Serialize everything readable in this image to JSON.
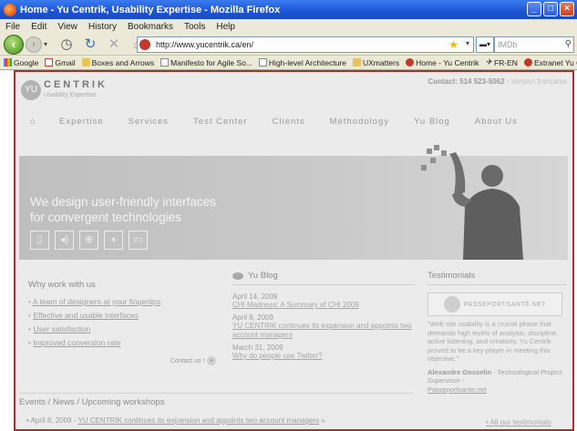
{
  "window": {
    "title": "Home - Yu Centrik, Usability Expertise - Mozilla Firefox",
    "controls": [
      "_",
      "□",
      "×"
    ]
  },
  "menu": [
    "File",
    "Edit",
    "View",
    "History",
    "Bookmarks",
    "Tools",
    "Help"
  ],
  "navbar": {
    "url": "http://www.yucentrik.ca/en/",
    "search_engine": "▬▾",
    "search_placeholder": "IMDb"
  },
  "bookmarks": [
    {
      "label": "Google",
      "icon": "google-icon"
    },
    {
      "label": "Gmail",
      "icon": "gmail-icon"
    },
    {
      "label": "Boxes and Arrows",
      "icon": "folder-icon"
    },
    {
      "label": "Manifesto for Agile So...",
      "icon": "page-icon"
    },
    {
      "label": "High-level Architecture",
      "icon": "page-icon"
    },
    {
      "label": "UXmatters",
      "icon": "folder-icon"
    },
    {
      "label": "Home - Yu Centrik",
      "icon": "yu-icon"
    },
    {
      "label": "FR-EN",
      "icon": "fren-icon"
    },
    {
      "label": "Extranet Yu Centrik",
      "icon": "yu-icon"
    }
  ],
  "site": {
    "logo_mark": "YU",
    "logo_name": "CENTRIK",
    "logo_tagline": "Usability Expertise",
    "contact_label": "Contact: 514 523-5062",
    "contact_separator": " - ",
    "contact_lang": "Version française",
    "nav": [
      "Expertise",
      "Services",
      "Test Center",
      "Clients",
      "Methodology",
      "Yu Blog",
      "About Us"
    ],
    "hero_line1": "We design user-friendly interfaces",
    "hero_line2": "for convergent technologies",
    "why_title": "Why work with us",
    "why_items": [
      "A team of designers at your fingertips",
      "Effective and usable interfaces",
      "User satisfaction",
      "Improved conversion rate"
    ],
    "contact_us": "Contact us !",
    "blog_title": "Yu Blog",
    "posts": [
      {
        "date": "April 14, 2009",
        "title": "CHI Madness: A Summary of CHI 2009"
      },
      {
        "date": "April 8, 2009",
        "title": "YU CENTRIK continues its expansion and appoints two account managers"
      },
      {
        "date": "March 31, 2009",
        "title": "Why do people use Twitter?"
      }
    ],
    "testimonials_title": "Testimonials",
    "testi_logo": "PASSEPORTSANTÉ.NET",
    "testi_quote": "\"Web site usability is a crucial phase that demands high levels of analysis, discipline, active listening, and creativity. Yu Centrik proved to be a key player in meeting this objective.\"",
    "testi_author": "Alexandre Gosselin",
    "testi_role": " - Technological Project Supervisor -",
    "testi_org": "Passeportsante.net",
    "all_testimonials": "All our testimonials",
    "events_title": "Events / News / Upcoming workshops",
    "event_date": "April 8, 2009 - ",
    "event_link": "YU CENTRIK continues its expansion and appoints two account managers",
    "event_more": " »"
  }
}
